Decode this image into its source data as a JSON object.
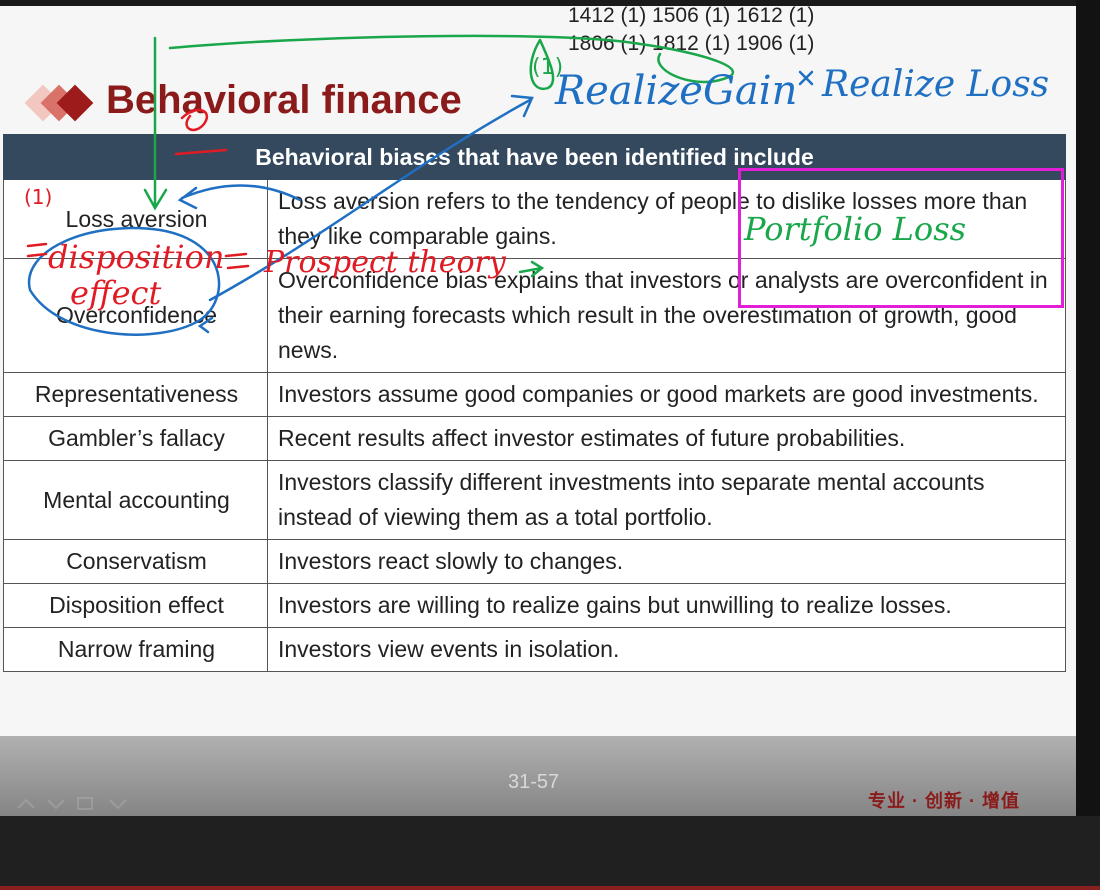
{
  "timestamps": [
    "1412 (1) 1506 (1) 1612 (1)",
    "1806 (1) 1812 (1) 1906 (1)"
  ],
  "slide": {
    "title": "Behavioral finance",
    "table_header": "Behavioral biases that have been identified include",
    "rows": [
      {
        "term": "Loss aversion",
        "description": "Loss aversion refers to the tendency of people to dislike losses more than they like comparable gains."
      },
      {
        "term": "Overconfidence",
        "description": "Overconfidence bias explains that investors or analysts are overconfident in their earning forecasts which result in the overestimation of growth, good news."
      },
      {
        "term": "Representativeness",
        "description": "Investors assume good companies or good markets are good investments."
      },
      {
        "term": "Gambler’s fallacy",
        "description": "Recent results affect investor estimates of future probabilities."
      },
      {
        "term": "Mental accounting",
        "description": "Investors classify different investments into separate mental accounts instead of viewing them as a total portfolio."
      },
      {
        "term": "Conservatism",
        "description": "Investors react slowly to changes."
      },
      {
        "term": "Disposition effect",
        "description": "Investors are willing to realize gains but unwilling to realize losses."
      },
      {
        "term": "Narrow framing",
        "description": "Investors view events in isolation."
      }
    ],
    "page_number": "31-57",
    "slogan": "专业 · 创新 · 增值"
  },
  "annotations": {
    "realize_gain": "RealizeGain",
    "realize_loss": "Realize Loss",
    "marker_1a": "(1)",
    "marker_1b": "(1)",
    "disposition": "disposition",
    "effect": "effect",
    "prospect_theory": "Prospect theory",
    "portfolio_loss": "Portfolio Loss"
  },
  "colors": {
    "title": "#8b1a1a",
    "header_bg": "#35495e",
    "ink_green": "#1aa64a",
    "ink_blue": "#1f6fc2",
    "ink_red": "#e01b24",
    "highlight": "#e21fd6"
  }
}
